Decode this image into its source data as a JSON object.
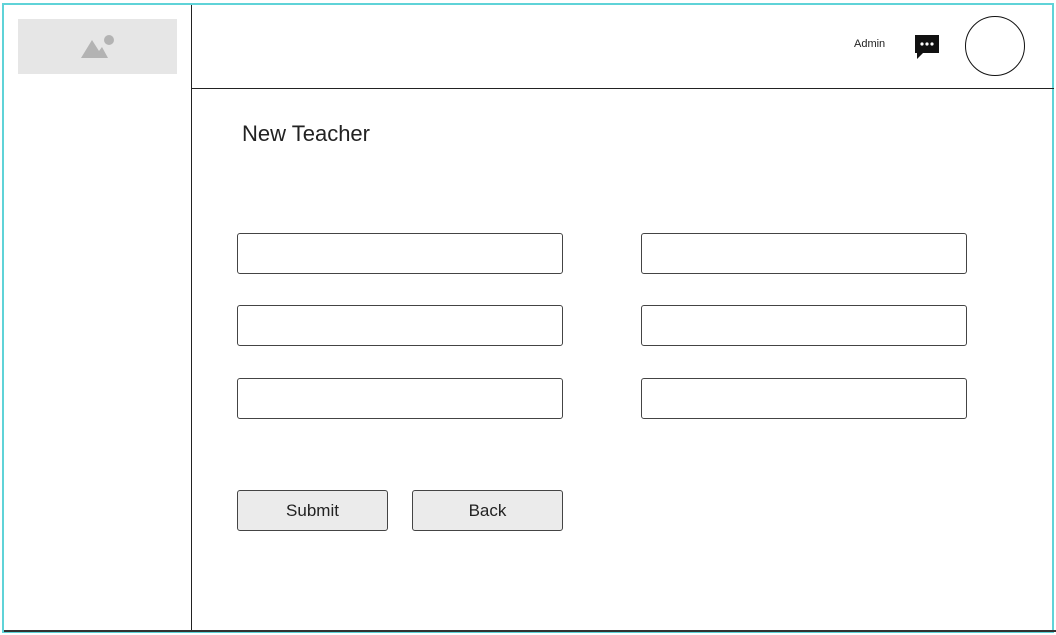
{
  "header": {
    "admin_label": "Admin"
  },
  "page": {
    "title": "New Teacher"
  },
  "form": {
    "fields": [
      "",
      "",
      "",
      "",
      "",
      ""
    ]
  },
  "buttons": {
    "submit_label": "Submit",
    "back_label": "Back"
  },
  "icons": {
    "logo": "image-placeholder-icon",
    "chat": "chat-bubble-icon"
  },
  "colors": {
    "frame_border": "#5fd3d8",
    "logo_bg": "#e6e6e6",
    "button_bg": "#ebebeb"
  }
}
